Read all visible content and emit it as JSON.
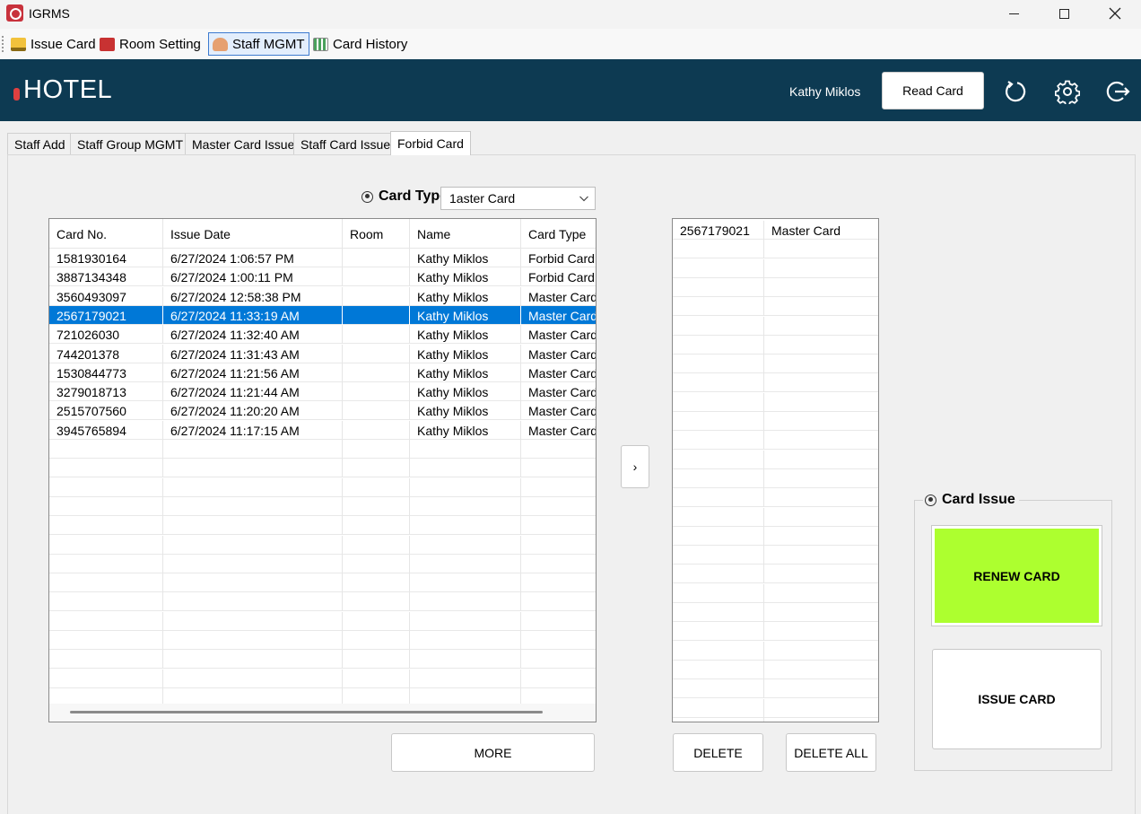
{
  "window": {
    "title": "IGRMS"
  },
  "toolbar": {
    "items": [
      {
        "label": "Issue Card"
      },
      {
        "label": "Room Setting"
      },
      {
        "label": "Staff MGMT"
      },
      {
        "label": "Card History"
      }
    ]
  },
  "header": {
    "logo": "HOTEL",
    "user": "Kathy Miklos",
    "read_card_label": "Read Card"
  },
  "tabs": [
    {
      "label": "Staff Add"
    },
    {
      "label": "Staff Group MGMT"
    },
    {
      "label": "Master Card Issue"
    },
    {
      "label": "Staff Card Issue"
    },
    {
      "label": "Forbid Card"
    }
  ],
  "card_type": {
    "label": "Card Type",
    "selected": "Master Card",
    "display": "1aster Card"
  },
  "left_table": {
    "columns": [
      "Card No.",
      "Issue Date",
      "Room",
      "Name",
      "Card Type"
    ],
    "rows": [
      [
        "1581930164",
        "6/27/2024 1:06:57 PM",
        "",
        "Kathy Miklos",
        "Forbid Card"
      ],
      [
        "3887134348",
        "6/27/2024 1:00:11 PM",
        "",
        "Kathy Miklos",
        "Forbid Card"
      ],
      [
        "3560493097",
        "6/27/2024 12:58:38 PM",
        "",
        "Kathy Miklos",
        "Master Card"
      ],
      [
        "2567179021",
        "6/27/2024 11:33:19 AM",
        "",
        "Kathy Miklos",
        "Master Card"
      ],
      [
        "721026030",
        "6/27/2024 11:32:40 AM",
        "",
        "Kathy Miklos",
        "Master Card"
      ],
      [
        "744201378",
        "6/27/2024 11:31:43 AM",
        "",
        "Kathy Miklos",
        "Master Card"
      ],
      [
        "1530844773",
        "6/27/2024 11:21:56 AM",
        "",
        "Kathy Miklos",
        "Master Card"
      ],
      [
        "3279018713",
        "6/27/2024 11:21:44 AM",
        "",
        "Kathy Miklos",
        "Master Card"
      ],
      [
        "2515707560",
        "6/27/2024 11:20:20 AM",
        "",
        "Kathy Miklos",
        "Master Card"
      ],
      [
        "3945765894",
        "6/27/2024 11:17:15 AM",
        "",
        "Kathy Miklos",
        "Master Card"
      ]
    ],
    "selected_index": 3
  },
  "right_table": {
    "rows": [
      [
        "2567179021",
        "Master Card"
      ]
    ]
  },
  "buttons": {
    "more": "MORE",
    "move": "›",
    "delete": "DELETE",
    "delete_all": "DELETE ALL"
  },
  "card_issue": {
    "label": "Card Issue",
    "renew": "RENEW CARD",
    "issue": "ISSUE CARD"
  },
  "colors": {
    "header_bg": "#0d3a52",
    "selection": "#0078d7",
    "renew_bg": "#adff2f"
  }
}
